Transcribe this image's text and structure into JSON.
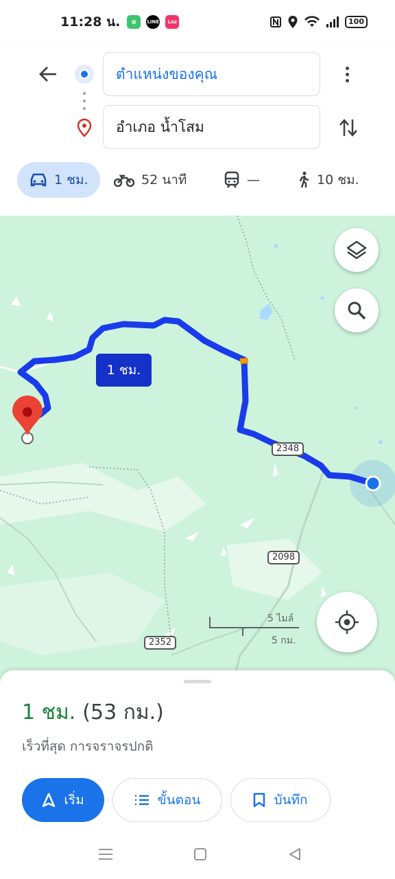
{
  "status_bar": {
    "time": "11:28 น.",
    "apps": [
      {
        "icon": "calendar-app-icon",
        "color": "#3ec46d",
        "text": ""
      },
      {
        "icon": "line-app-icon",
        "color": "#000000",
        "text": "LINE"
      },
      {
        "icon": "lazada-app-icon",
        "color": "#f3356c",
        "text": "Laz"
      }
    ],
    "battery": "100"
  },
  "directions": {
    "origin": "ตำแหน่งของคุณ",
    "destination": "อำเภอ น้ำโสม"
  },
  "modes": {
    "drive": {
      "icon": "car-icon",
      "label": "1 ชม."
    },
    "motorcycle": {
      "icon": "motorcycle-icon",
      "label": "52 นาที"
    },
    "transit": {
      "icon": "train-icon",
      "label": "—"
    },
    "walk": {
      "icon": "walk-icon",
      "label": "10 ชม."
    }
  },
  "map": {
    "duration_label": "1 ชม.",
    "road_shields": [
      "2348",
      "2098",
      "2352"
    ],
    "scale": {
      "miles": "5 ไมล์",
      "km": "5 กม."
    },
    "colors": {
      "route": "#1a3bea",
      "land": "#cdf3dc",
      "water": "#aadaff",
      "pin": "#ea4335"
    }
  },
  "sheet": {
    "time": "1 ชม.",
    "distance": "(53 กม.)",
    "subtitle": "เร็วที่สุด การจราจรปกติ",
    "buttons": {
      "start": "เริ่ม",
      "steps": "ขั้นตอน",
      "save": "บันทึก"
    }
  }
}
